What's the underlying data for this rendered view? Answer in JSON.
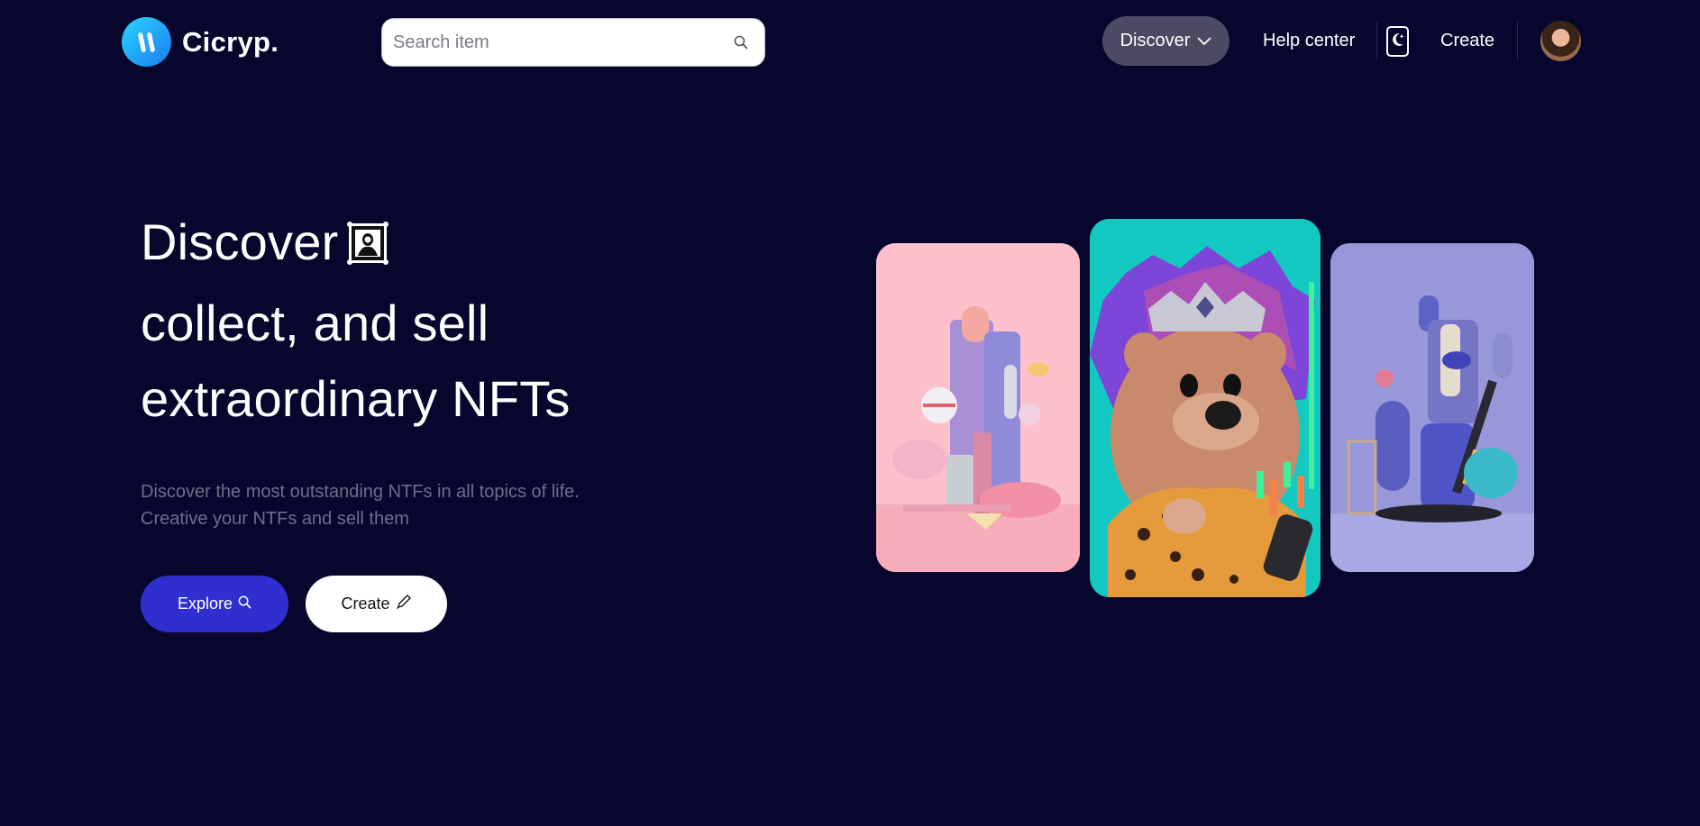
{
  "header": {
    "brand": "Cicryp.",
    "search": {
      "placeholder": "Search item",
      "value": ""
    },
    "nav": {
      "discover_label": "Discover",
      "help_label": "Help center",
      "create_label": "Create"
    }
  },
  "hero": {
    "title_line1": "Discover",
    "title_line2": "collect, and sell",
    "title_line3": "extraordinary NFTs",
    "subtitle_line1": "Discover the most outstanding NTFs in all topics of life.",
    "subtitle_line2": "Creative your NTFs and sell them",
    "explore_label": "Explore",
    "create_label": "Create"
  },
  "icons": {
    "logo": "logo-mark-icon",
    "search": "search-icon",
    "discover_chevron": "chevron-down-icon",
    "theme": "moon-icon",
    "title_decoration": "framed-picture-icon",
    "explore": "search-icon",
    "create": "pencil-icon"
  },
  "colors": {
    "background": "#07062d",
    "explore_button": "#2f2fcf",
    "discover_pill": "#4b4a62",
    "subtitle_text": "#6f6e87",
    "card_pink": "#fcc1cc",
    "card_teal": "#14c8c2",
    "card_purple": "#9797da"
  }
}
